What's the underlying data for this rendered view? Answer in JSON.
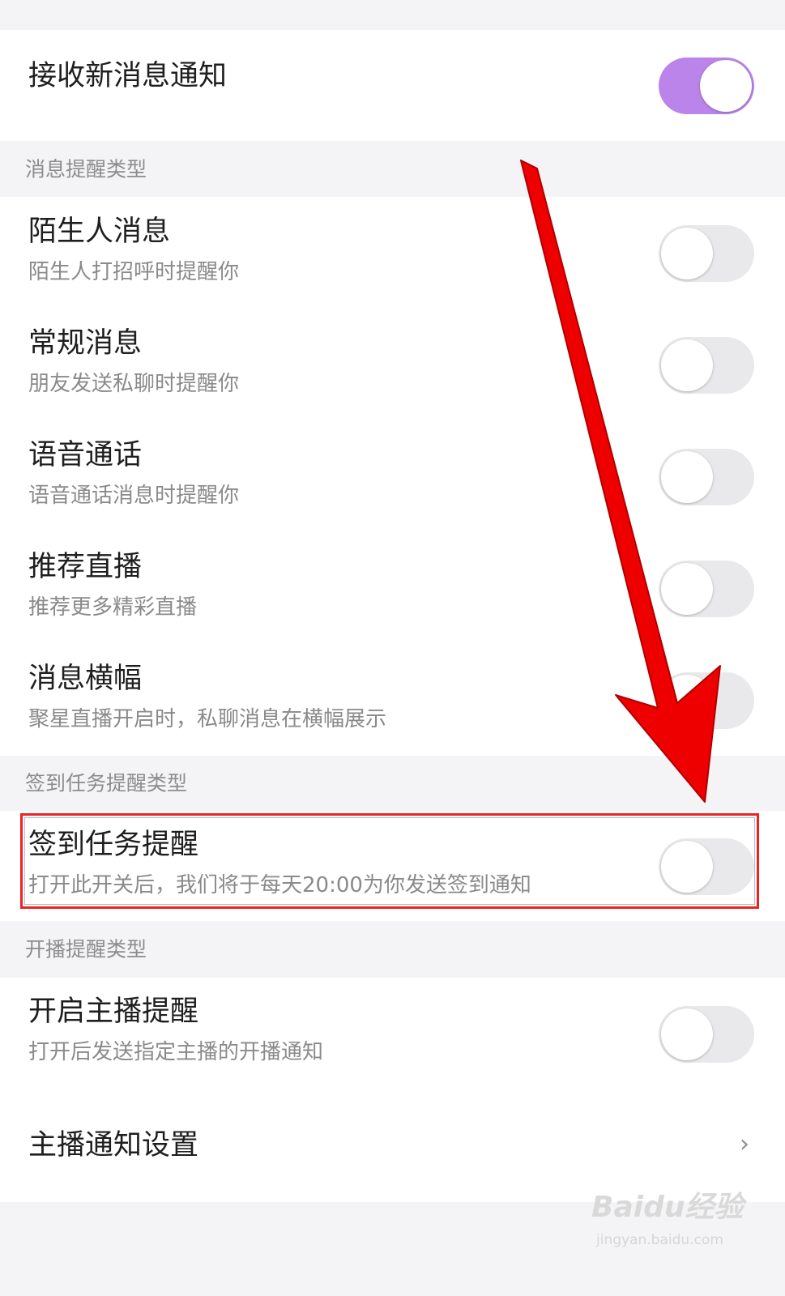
{
  "master": {
    "title": "接收新消息通知",
    "enabled": true
  },
  "sections": {
    "message_types": "消息提醒类型",
    "signin_types": "签到任务提醒类型",
    "broadcast_types": "开播提醒类型"
  },
  "items": {
    "stranger": {
      "title": "陌生人消息",
      "subtitle": "陌生人打招呼时提醒你",
      "enabled": false
    },
    "regular": {
      "title": "常规消息",
      "subtitle": "朋友发送私聊时提醒你",
      "enabled": false
    },
    "voice": {
      "title": "语音通话",
      "subtitle": "语音通话消息时提醒你",
      "enabled": false
    },
    "recommend": {
      "title": "推荐直播",
      "subtitle": "推荐更多精彩直播",
      "enabled": false
    },
    "banner": {
      "title": "消息横幅",
      "subtitle": "聚星直播开启时，私聊消息在横幅展示",
      "enabled": false
    },
    "signin": {
      "title": "签到任务提醒",
      "subtitle": "打开此开关后，我们将于每天20:00为你发送签到通知",
      "enabled": false
    },
    "anchor": {
      "title": "开启主播提醒",
      "subtitle": "打开后发送指定主播的开播通知",
      "enabled": false
    }
  },
  "anchor_settings": {
    "title": "主播通知设置",
    "chevron": "›"
  },
  "colors": {
    "accent": "#bb84ea",
    "annotation": "#ee0000",
    "toggle_off": "#e9e9eb",
    "background": "#f4f4f6"
  },
  "watermark": {
    "logo": "Baidu经验",
    "url": "jingyan.baidu.com"
  }
}
